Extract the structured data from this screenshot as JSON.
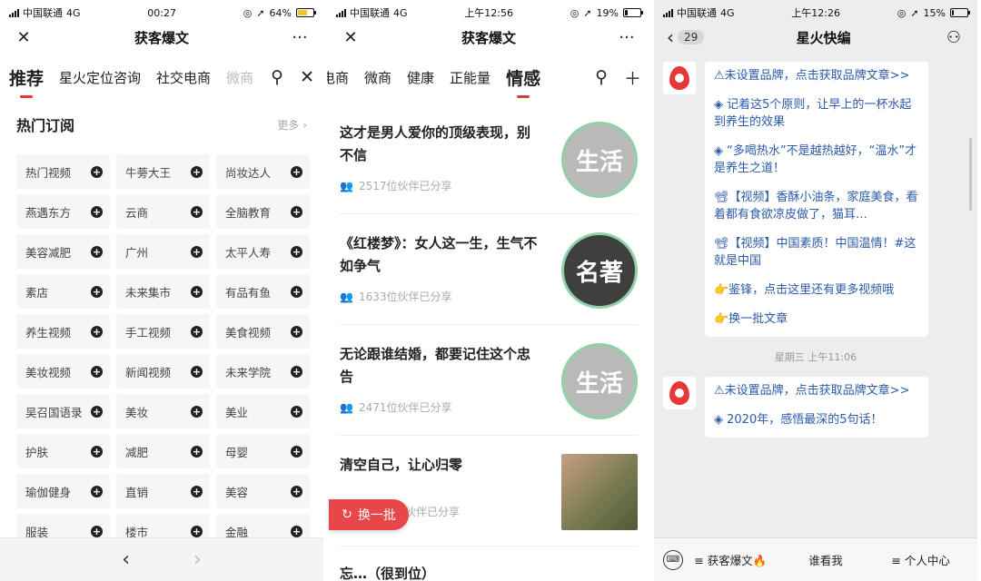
{
  "screen1": {
    "status": {
      "carrier": "中国联通",
      "network": "4G",
      "time": "00:27",
      "battery_text": "64%",
      "battery_level": 0.64,
      "battery_color": "#f3c623"
    },
    "title": "获客爆文",
    "tabs": [
      "推荐",
      "星火定位咨询",
      "社交电商",
      "微商"
    ],
    "section_title": "热门订阅",
    "more_label": "更多 ›",
    "chips": [
      "热门视频",
      "牛蒡大王",
      "尚妆达人",
      "燕遇东方",
      "云商",
      "全脑教育",
      "美容减肥",
      "广州",
      "太平人寿",
      "素店",
      "未来集市",
      "有品有鱼",
      "养生视频",
      "手工视频",
      "美食视频",
      "美妆视频",
      "新闻视频",
      "未来学院",
      "吴召国语录",
      "美妆",
      "美业",
      "护肤",
      "减肥",
      "母婴",
      "瑜伽健身",
      "直销",
      "美容",
      "服装",
      "楼市",
      "金融"
    ]
  },
  "screen2": {
    "status": {
      "carrier": "中国联通",
      "network": "4G",
      "time": "上午12:56",
      "battery_text": "19%",
      "battery_level": 0.19,
      "battery_color": "#111111"
    },
    "title": "获客爆文",
    "tabs": [
      "电商",
      "微商",
      "健康",
      "正能量",
      "情感"
    ],
    "articles": [
      {
        "headline": "这才是男人爱你的顶级表现，别不信",
        "meta": "2517位伙伴已分享",
        "thumb_label": "生活"
      },
      {
        "headline": "《红楼梦》：女人这一生，生气不如争气",
        "meta": "1633位伙伴已分享",
        "thumb_label": "名著"
      },
      {
        "headline": "无论跟谁结婚，都要记住这个忠告",
        "meta": "2471位伙伴已分享",
        "thumb_label": "生活"
      },
      {
        "headline": "清空自己，让心归零",
        "meta": "伙伴已分享",
        "thumb_label": ""
      }
    ],
    "partial_headline": "忘…（很到位）",
    "refresh_label": "换一批"
  },
  "screen3": {
    "status": {
      "carrier": "中国联通",
      "network": "4G",
      "time": "上午12:26",
      "battery_text": "15%",
      "battery_level": 0.15,
      "battery_color": "#111111"
    },
    "title": "星火快编",
    "unread_count": "29",
    "message1": [
      "⚠未设置品牌，点击获取品牌文章>>",
      "◈ 记着这5个原则，让早上的一杯水起到养生的效果",
      "◈ “多喝热水”不是越热越好，“温水”才是养生之道！",
      "📽【视频】香酥小油条，家庭美食，看着都有食欲凉皮做了，猫耳…",
      "📽【视频】中国素质！中国温情！#这就是中国",
      "👉鉴锋，点击这里还有更多视频哦",
      "👉换一批文章"
    ],
    "timestamp": "星期三 上午11:06",
    "message2": [
      "⚠未设置品牌，点击获取品牌文章>>",
      "◈ 2020年，感悟最深的5句话！"
    ],
    "bottom_menu": [
      "≡ 获客爆文🔥",
      "谁看我",
      "≡ 个人中心"
    ]
  }
}
